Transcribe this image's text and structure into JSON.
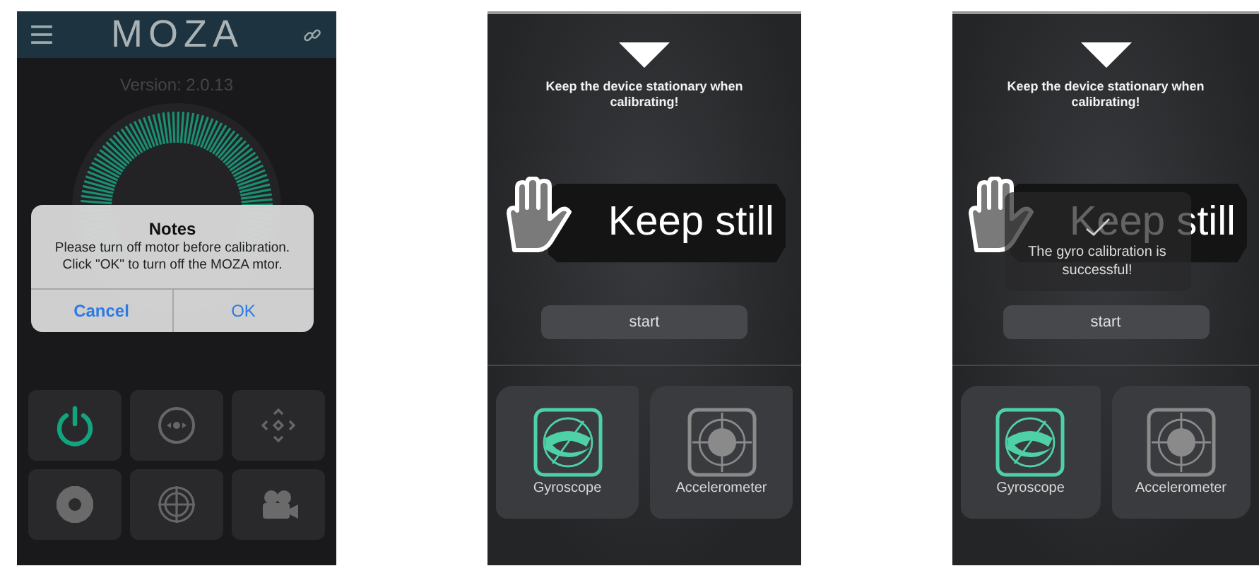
{
  "screens": [
    {
      "kind": "home",
      "logo": "MOZA",
      "version": "Version: 2.0.13",
      "dialog": {
        "title": "Notes",
        "message": "Please turn off motor before calibration. Click \"OK\" to turn off the MOZA mtor.",
        "buttons": [
          "Cancel",
          "OK"
        ]
      },
      "motor_on": true
    },
    {
      "kind": "calibration",
      "instruction": "Keep the device stationary when calibrating!",
      "banner": "Keep still",
      "start_button": "start",
      "modes": [
        {
          "label": "Gyroscope",
          "selected": true
        },
        {
          "label": "Accelerometer",
          "selected": false
        }
      ]
    },
    {
      "kind": "calibration",
      "instruction": "Keep the device stationary when calibrating!",
      "banner": "Keep still",
      "toast": "The gyro calibration is successful!",
      "start_button": "start",
      "modes": [
        {
          "label": "Gyroscope",
          "selected": true
        },
        {
          "label": "Accelerometer",
          "selected": false
        }
      ]
    }
  ]
}
